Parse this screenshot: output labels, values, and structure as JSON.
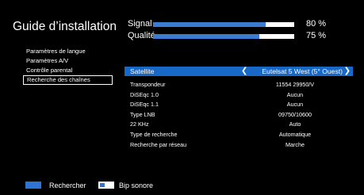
{
  "header": {
    "title": "Guide d’installation"
  },
  "meters": {
    "signal": {
      "label": "Signal",
      "value_text": "80 %",
      "level": 0.8
    },
    "quality": {
      "label": "Qualité",
      "value_text": "75 %",
      "level": 0.75
    }
  },
  "colors": {
    "accent": "#1868c8",
    "bar_fill": "#3b7bd0",
    "key_blue": "#2f74d3",
    "background": "#000000"
  },
  "menu": {
    "items": [
      {
        "label": "Paramètres de langue"
      },
      {
        "label": "Paramètres A/V"
      },
      {
        "label": "Contrôle parental"
      },
      {
        "label": "Recherche des chaînes",
        "selected": true
      }
    ]
  },
  "satellite": {
    "label": "Satellite",
    "value": "Eutelsat 5 West (5° Ouest)",
    "left_arrow_icon": "chevron-left",
    "right_arrow_icon": "chevron-right"
  },
  "params": [
    {
      "key": "Transpondeur",
      "value": "11554 29950/V"
    },
    {
      "key": "DiSEqc 1.0",
      "value": "Aucun"
    },
    {
      "key": "DiSEqc 1.1",
      "value": "Aucun"
    },
    {
      "key": "Type LNB",
      "value": "09750/10600"
    },
    {
      "key": "22 KHz",
      "value": "Auto"
    },
    {
      "key": "Type de recherche",
      "value": "Automatique"
    },
    {
      "key": "Recherche par réseau",
      "value": "Marche"
    }
  ],
  "footer": {
    "blue_key_label": "Rechercher",
    "white_key_label": "Bip sonore"
  }
}
